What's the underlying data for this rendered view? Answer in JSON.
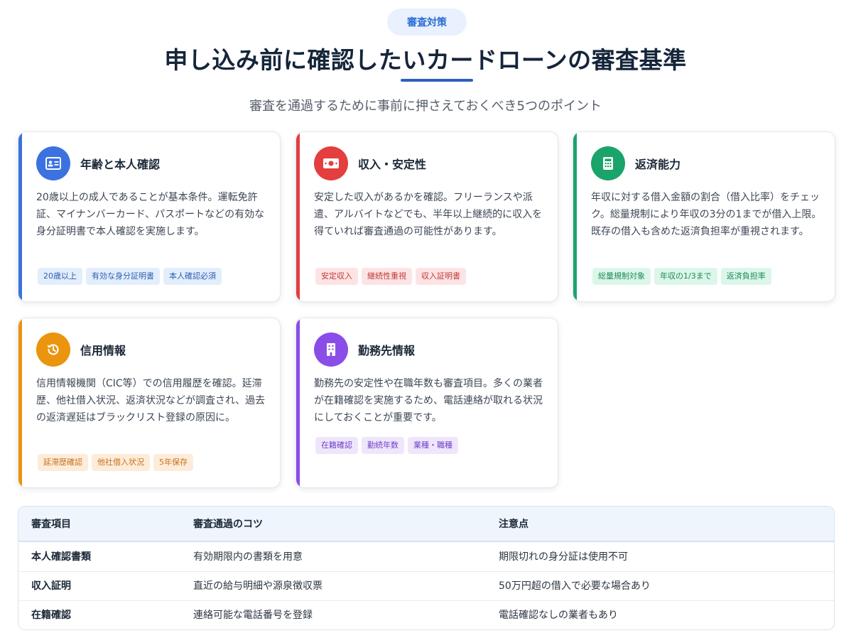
{
  "header": {
    "badge": "審査対策",
    "title": "申し込み前に確認したいカードローンの審査基準",
    "subtitle": "審査を通過するために事前に押さえておくべき5つのポイント"
  },
  "colors": {
    "blue": "#3b72e0",
    "red": "#e53e3e",
    "green": "#1aa36b",
    "orange": "#ea950d",
    "purple": "#8b4de8"
  },
  "cards": [
    {
      "title": "年齢と本人確認",
      "icon": "id-card-icon",
      "body": "20歳以上の成人であることが基本条件。運転免許証、マイナンバーカード、パスポートなどの有効な身分証明書で本人確認を実施します。",
      "tags": [
        "20歳以上",
        "有効な身分証明書",
        "本人確認必須"
      ]
    },
    {
      "title": "収入・安定性",
      "icon": "money-bill-icon",
      "body": "安定した収入があるかを確認。フリーランスや派遣、アルバイトなどでも、半年以上継続的に収入を得ていれば審査通過の可能性があります。",
      "tags": [
        "安定収入",
        "継続性重視",
        "収入証明書"
      ]
    },
    {
      "title": "返済能力",
      "icon": "calculator-icon",
      "body": "年収に対する借入金額の割合（借入比率）をチェック。総量規制により年収の3分の1までが借入上限。既存の借入も含めた返済負担率が重視されます。",
      "tags": [
        "総量規制対象",
        "年収の1/3まで",
        "返済負担率"
      ]
    },
    {
      "title": "信用情報",
      "icon": "history-icon",
      "body": "信用情報機関（CIC等）での信用履歴を確認。延滞歴、他社借入状況、返済状況などが調査され、過去の返済遅延はブラックリスト登録の原因に。",
      "tags": [
        "延滞歴確認",
        "他社借入状況",
        "5年保存"
      ]
    },
    {
      "title": "勤務先情報",
      "icon": "building-icon",
      "body": "勤務先の安定性や在職年数も審査項目。多くの業者が在籍確認を実施するため、電話連絡が取れる状況にしておくことが重要です。",
      "tags": [
        "在籍確認",
        "勤続年数",
        "業種・職種"
      ]
    }
  ],
  "table": {
    "headers": [
      "審査項目",
      "審査通過のコツ",
      "注意点"
    ],
    "rows": [
      [
        "本人確認書類",
        "有効期限内の書類を用意",
        "期限切れの身分証は使用不可"
      ],
      [
        "収入証明",
        "直近の給与明細や源泉徴収票",
        "50万円超の借入で必要な場合あり"
      ],
      [
        "在籍確認",
        "連絡可能な電話番号を登録",
        "電話確認なしの業者もあり"
      ]
    ]
  }
}
